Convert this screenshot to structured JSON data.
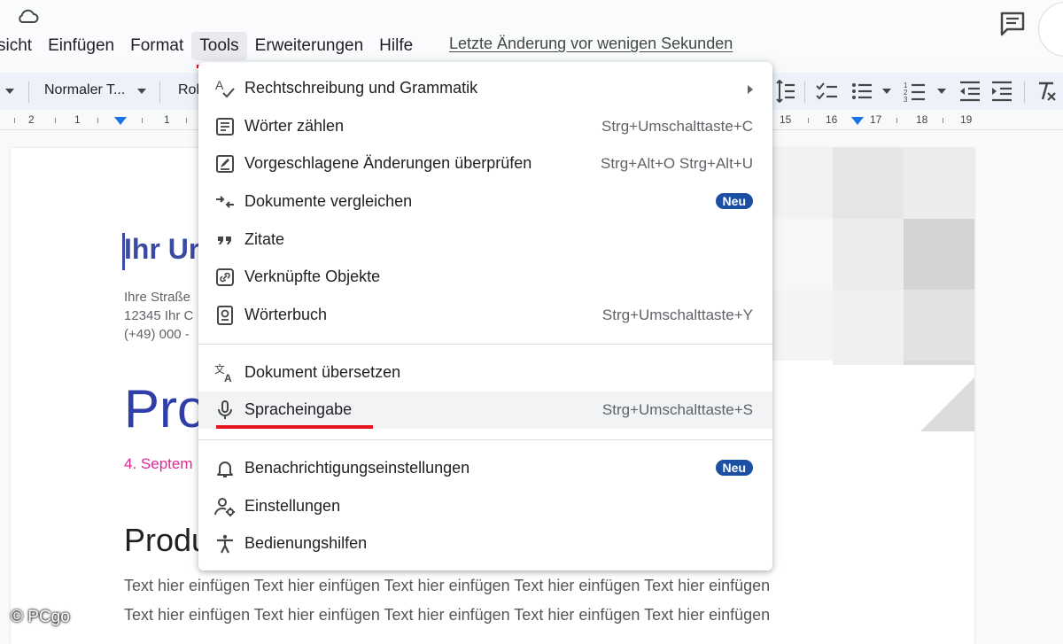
{
  "menubar": {
    "items": [
      "sicht",
      "Einfügen",
      "Format",
      "Tools",
      "Erweiterungen",
      "Hilfe"
    ],
    "last_change": "Letzte Änderung vor wenigen Sekunden"
  },
  "toolbar": {
    "style_select": "Normaler T...",
    "font_select": "Rol"
  },
  "ruler": {
    "left_numbers": [
      "2",
      "1",
      "1"
    ],
    "right_numbers": [
      "15",
      "16",
      "17",
      "18",
      "19"
    ]
  },
  "tools_menu": {
    "items": [
      {
        "label": "Rechtschreibung und Grammatik",
        "shortcut": "",
        "badge": "",
        "icon": "spellcheck-icon",
        "submenu": true
      },
      {
        "label": "Wörter zählen",
        "shortcut": "Strg+Umschalttaste+C",
        "badge": "",
        "icon": "word-count-icon"
      },
      {
        "label": "Vorgeschlagene Änderungen überprüfen",
        "shortcut": "Strg+Alt+O Strg+Alt+U",
        "badge": "",
        "icon": "review-edits-icon"
      },
      {
        "label": "Dokumente vergleichen",
        "shortcut": "",
        "badge": "Neu",
        "icon": "compare-icon"
      },
      {
        "label": "Zitate",
        "shortcut": "",
        "badge": "",
        "icon": "quote-icon"
      },
      {
        "label": "Verknüpfte Objekte",
        "shortcut": "",
        "badge": "",
        "icon": "link-objects-icon"
      },
      {
        "label": "Wörterbuch",
        "shortcut": "Strg+Umschalttaste+Y",
        "badge": "",
        "icon": "dictionary-icon"
      },
      {
        "label": "Dokument übersetzen",
        "shortcut": "",
        "badge": "",
        "icon": "translate-icon"
      },
      {
        "label": "Spracheingabe",
        "shortcut": "Strg+Umschalttaste+S",
        "badge": "",
        "icon": "microphone-icon"
      },
      {
        "label": "Benachrichtigungseinstellungen",
        "shortcut": "",
        "badge": "Neu",
        "icon": "bell-icon"
      },
      {
        "label": "Einstellungen",
        "shortcut": "",
        "badge": "",
        "icon": "user-settings-icon"
      },
      {
        "label": "Bedienungshilfen",
        "shortcut": "",
        "badge": "",
        "icon": "accessibility-icon"
      }
    ]
  },
  "document": {
    "company": "Ihr Ur",
    "address_lines": [
      "Ihre Straße",
      "12345 Ihr C",
      "(+49) 000 -"
    ],
    "title": "Pro",
    "date": "4. Septem",
    "heading": "Produ",
    "body_lines": [
      "Text hier einfügen Text hier einfügen Text hier einfügen Text hier einfügen Text hier einfügen",
      "Text hier einfügen Text hier einfügen Text hier einfügen Text hier einfügen Text hier einfügen"
    ]
  },
  "watermark": "© PCgo",
  "colors": {
    "accent_red": "#e3141b",
    "badge_blue": "#1a4fa3",
    "title_blue": "#2f3ea8",
    "date_pink": "#e52592"
  }
}
